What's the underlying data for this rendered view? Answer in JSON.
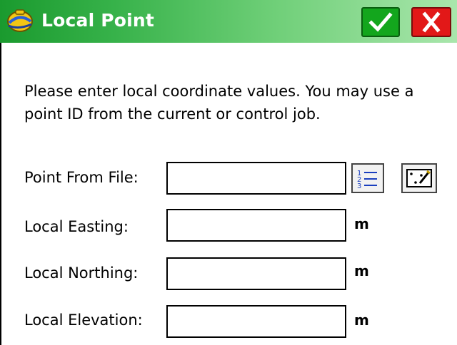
{
  "window": {
    "title": "Local Point",
    "icons": {
      "app": "helmet-icon",
      "ok": "checkmark-icon",
      "close": "close-icon"
    },
    "colors": {
      "title_bar_start": "#1a9a2e",
      "title_bar_end": "#a9e6ac",
      "ok_button": "#13a61d",
      "close_button": "#e21818"
    }
  },
  "intro_text": "Please enter local coordinate values.  You may use a point ID from the current or control job.",
  "form": {
    "point_from_file": {
      "label": "Point From File:",
      "value": "",
      "buttons": [
        "list-icon",
        "map-select-icon"
      ]
    },
    "local_easting": {
      "label": "Local Easting:",
      "value": "",
      "unit": "m"
    },
    "local_northing": {
      "label": "Local Northing:",
      "value": "",
      "unit": "m"
    },
    "local_elevation": {
      "label": "Local Elevation:",
      "value": "",
      "unit": "m"
    }
  }
}
